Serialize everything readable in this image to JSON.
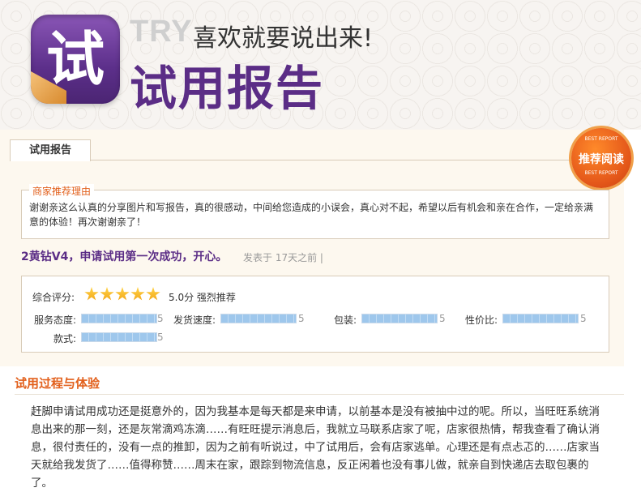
{
  "header": {
    "logo_char": "试",
    "try_word": "TRY",
    "slogan": "喜欢就要说出来!",
    "title": "试用报告"
  },
  "report": {
    "tab_label": "试用报告",
    "badge": {
      "top_text": "BEST REPORT",
      "main_text": "推荐阅读",
      "bottom_text": "BEST REPORT"
    },
    "recommend": {
      "label": "商家推荐理由",
      "text": "谢谢亲这么认真的分享图片和写报告，真的很感动，中间给您造成的小误会，真心对不起，希望以后有机会和亲在合作，一定给亲满意的体验！再次谢谢亲了！"
    },
    "headline": "2黄钻V4，申请试用第一次成功，开心。",
    "posted": "发表于 17天之前 |",
    "rating": {
      "overall_label": "综合评分:",
      "stars": 5,
      "overall_score": "5.0分 强烈推荐",
      "metrics": [
        {
          "label": "服务态度:",
          "value": "5",
          "fill": 1.0
        },
        {
          "label": "发货速度:",
          "value": "5",
          "fill": 1.0
        },
        {
          "label": "包装:",
          "value": "5",
          "fill": 1.0
        },
        {
          "label": "性价比:",
          "value": "5",
          "fill": 1.0
        },
        {
          "label": "款式:",
          "value": "5",
          "fill": 1.0
        }
      ]
    }
  },
  "process": {
    "title": "试用过程与体验",
    "text": "赶脚申请试用成功还是挺意外的，因为我基本是每天都是来申请，以前基本是没有被抽中过的呢。所以，当旺旺系统消息出来的那一刻，还是灰常滴鸡冻滴……有旺旺提示消息后，我就立马联系店家了呢，店家很热情，帮我查看了确认消息，很付责任的，没有一点的推卸，因为之前有听说过，中了试用后，会有店家逃单。心理还是有点忐忑的……店家当天就给我发货了……值得称赞……周末在家，跟踪到物流信息，反正闲着也没有事儿做，就亲自到快递店去取包裹的了。"
  },
  "colors": {
    "purple": "#5b2d86",
    "orange": "#e2601c"
  }
}
